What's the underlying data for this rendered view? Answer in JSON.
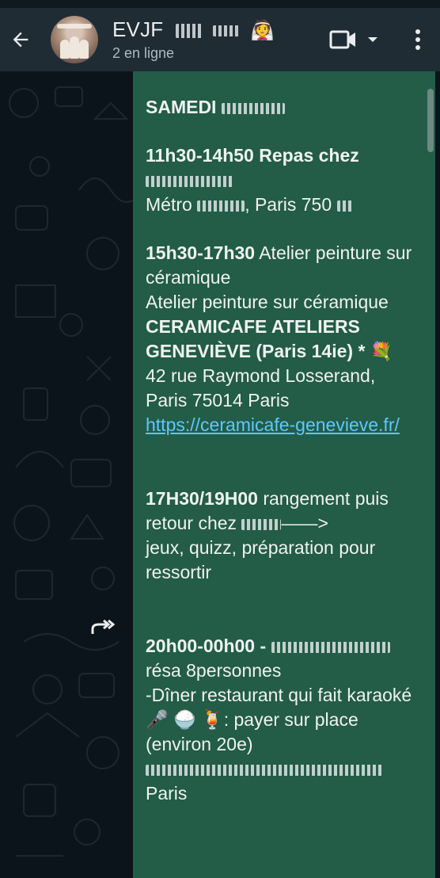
{
  "header": {
    "title": "EVJF",
    "title_emoji": "👰",
    "subtitle": "2 en ligne"
  },
  "message": {
    "date_heading": "SAMEDI",
    "slot1_time_title": "11h30-14h50 Repas chez",
    "slot1_address_prefix": "Métro",
    "slot1_address_city": ", Paris 750",
    "slot2_title_bold": "15h30-17h30",
    "slot2_title_rest": " Atelier peinture sur céramique",
    "slot2_desc_prefix": "Atelier peinture sur céramique ",
    "slot2_desc_bold": "CERAMICAFE ATELIERS GENEVIÈVE (Paris 14ie) *",
    "slot2_address_line1": "42 rue Raymond Losserand,",
    "slot2_address_line2": "Paris  75014 Paris",
    "slot2_link": "https://ceramicafe-genevieve.fr/",
    "slot3_title_bold": "17H30/19H00",
    "slot3_title_rest": " rangement puis retour chez ",
    "slot3_arrow": "——>",
    "slot3_rest": "jeux, quizz, préparation pour ressortir",
    "slot4_title_bold": "20h00-00h00 -",
    "slot4_line2": "résa 8personnes",
    "slot4_line3": "-Dîner restaurant qui fait karaoké",
    "slot4_line3b": ": payer sur place (environ 20e)",
    "slot4_city": "Paris"
  },
  "colors": {
    "header_bg": "#1f2c34",
    "chat_bg": "#0b141a",
    "bubble_bg": "#235c47",
    "link": "#5ec8ff"
  },
  "icons": {
    "back": "arrow-left-icon",
    "video": "video-camera-icon",
    "dropdown": "chevron-down-icon",
    "menu": "more-vertical-icon",
    "forward": "forward-icon"
  }
}
